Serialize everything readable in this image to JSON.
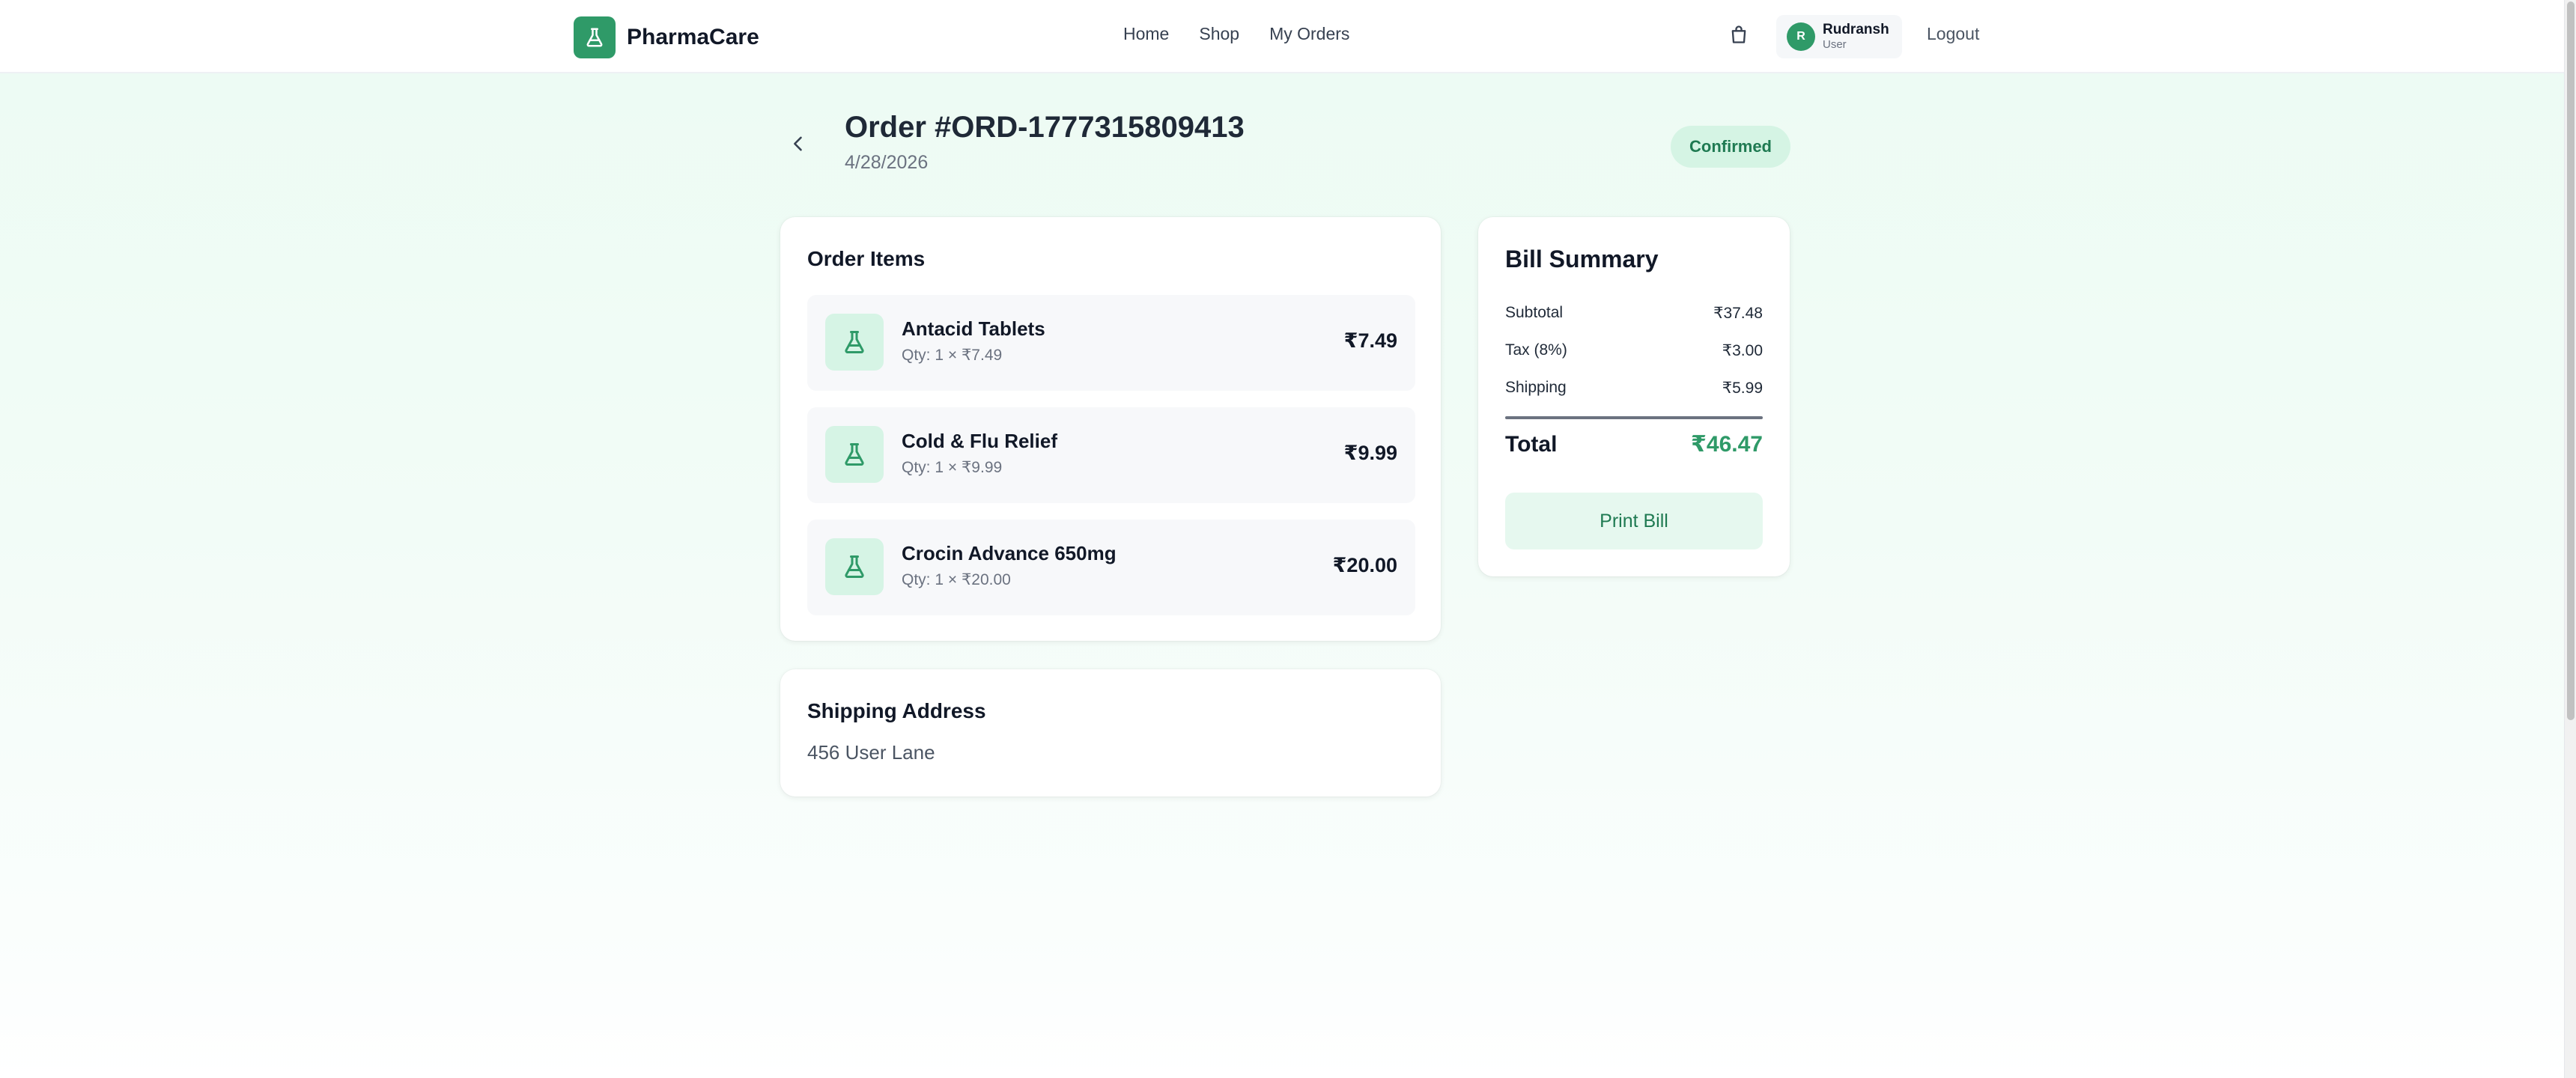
{
  "header": {
    "brand": "PharmaCare",
    "nav": [
      "Home",
      "Shop",
      "My Orders"
    ],
    "user": {
      "initial": "R",
      "name": "Rudransh",
      "role": "User"
    },
    "logout": "Logout"
  },
  "order": {
    "title": "Order #ORD-1777315809413",
    "date": "4/28/2026",
    "status": "Confirmed"
  },
  "items_section": {
    "title": "Order Items",
    "items": [
      {
        "name": "Antacid Tablets",
        "qty": "Qty: 1 × ₹7.49",
        "price": "₹7.49"
      },
      {
        "name": "Cold & Flu Relief",
        "qty": "Qty: 1 × ₹9.99",
        "price": "₹9.99"
      },
      {
        "name": "Crocin Advance 650mg",
        "qty": "Qty: 1 × ₹20.00",
        "price": "₹20.00"
      }
    ]
  },
  "shipping": {
    "title": "Shipping Address",
    "address": "456 User Lane"
  },
  "bill": {
    "title": "Bill Summary",
    "subtotal_label": "Subtotal",
    "subtotal": "₹37.48",
    "tax_label": "Tax (8%)",
    "tax": "₹3.00",
    "shipping_label": "Shipping",
    "shipping": "₹5.99",
    "total_label": "Total",
    "total": "₹46.47",
    "print_label": "Print Bill"
  },
  "icons": {
    "brand": "flask-icon",
    "cart": "shopping-bag-icon",
    "back": "chevron-left-icon",
    "item": "flask-icon"
  },
  "colors": {
    "brand": "#2f9a68",
    "status_bg": "#d5f4e4",
    "status_text": "#1f7a52"
  }
}
